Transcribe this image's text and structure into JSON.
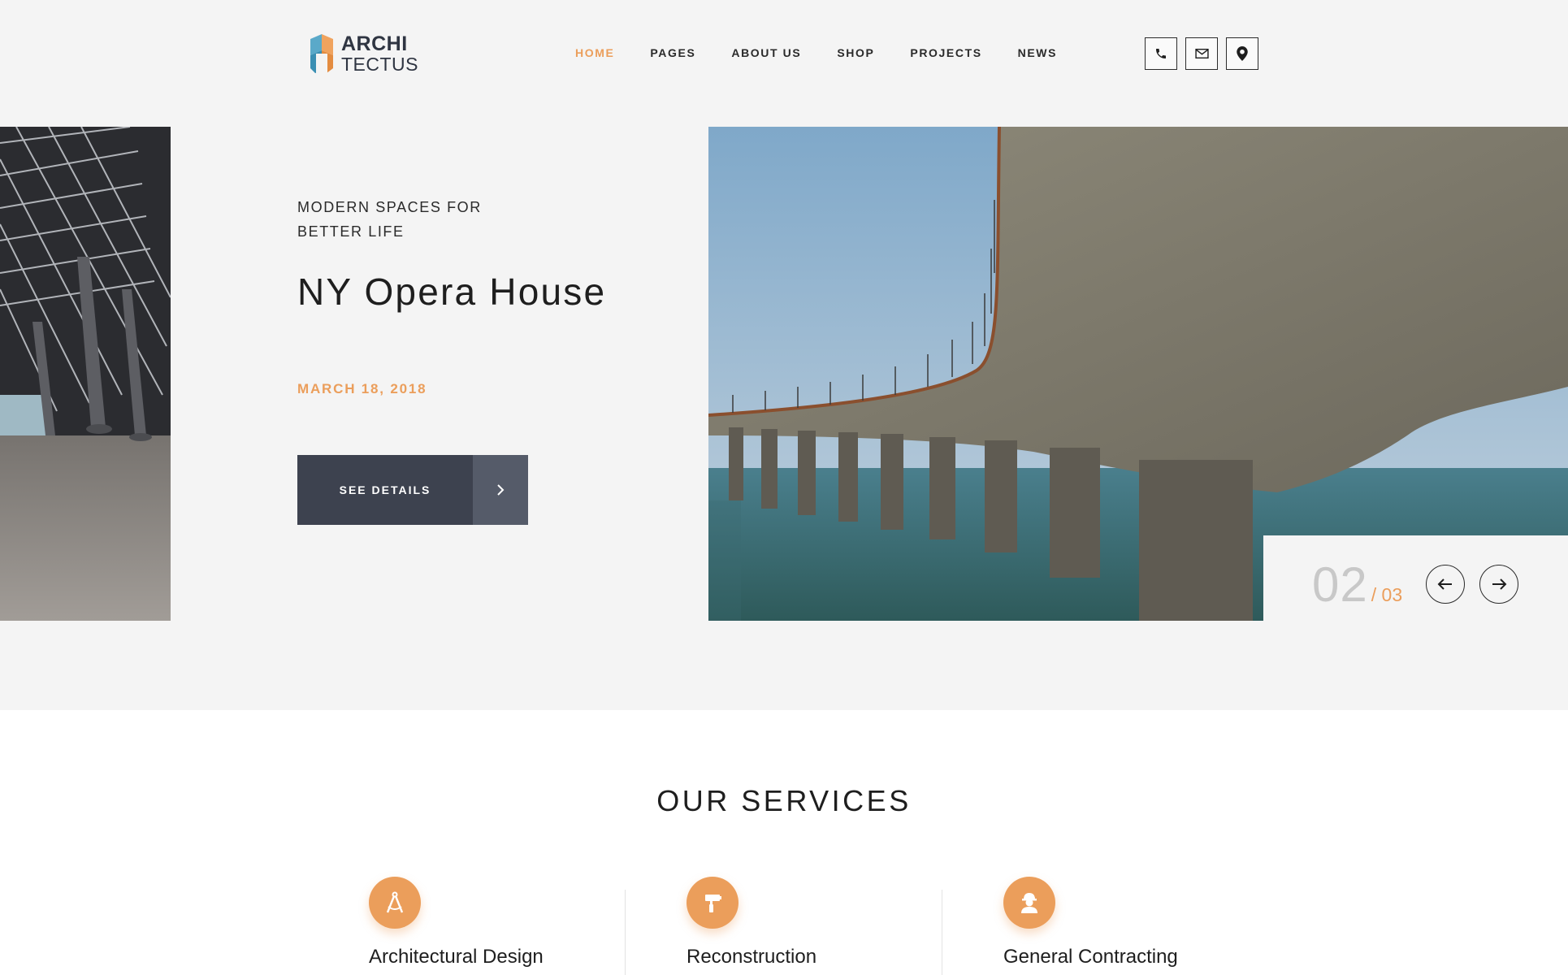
{
  "header": {
    "logo": {
      "line1": "ARCHI",
      "line2": "TECTUS"
    },
    "nav": [
      {
        "label": "HOME",
        "active": true
      },
      {
        "label": "PAGES",
        "active": false
      },
      {
        "label": "ABOUT US",
        "active": false
      },
      {
        "label": "SHOP",
        "active": false
      },
      {
        "label": "PROJECTS",
        "active": false
      },
      {
        "label": "NEWS",
        "active": false
      }
    ],
    "contact_icons": [
      "phone-icon",
      "mail-icon",
      "location-pin-icon"
    ]
  },
  "slider": {
    "eyebrow": "MODERN SPACES FOR BETTER LIFE",
    "title": "NY Opera House",
    "date": "MARCH 18, 2018",
    "button_label": "SEE DETAILS",
    "current": "02",
    "total": "/ 03"
  },
  "services": {
    "title": "OUR SERVICES",
    "items": [
      {
        "name": "Architectural Design",
        "icon": "compass-icon"
      },
      {
        "name": "Reconstruction",
        "icon": "paint-roller-icon"
      },
      {
        "name": "General Contracting",
        "icon": "worker-icon"
      }
    ]
  },
  "colors": {
    "accent": "#eb9e5b",
    "button_dark": "#3d424f",
    "button_arrow": "#555b69",
    "hero_bg": "#f4f4f4"
  }
}
